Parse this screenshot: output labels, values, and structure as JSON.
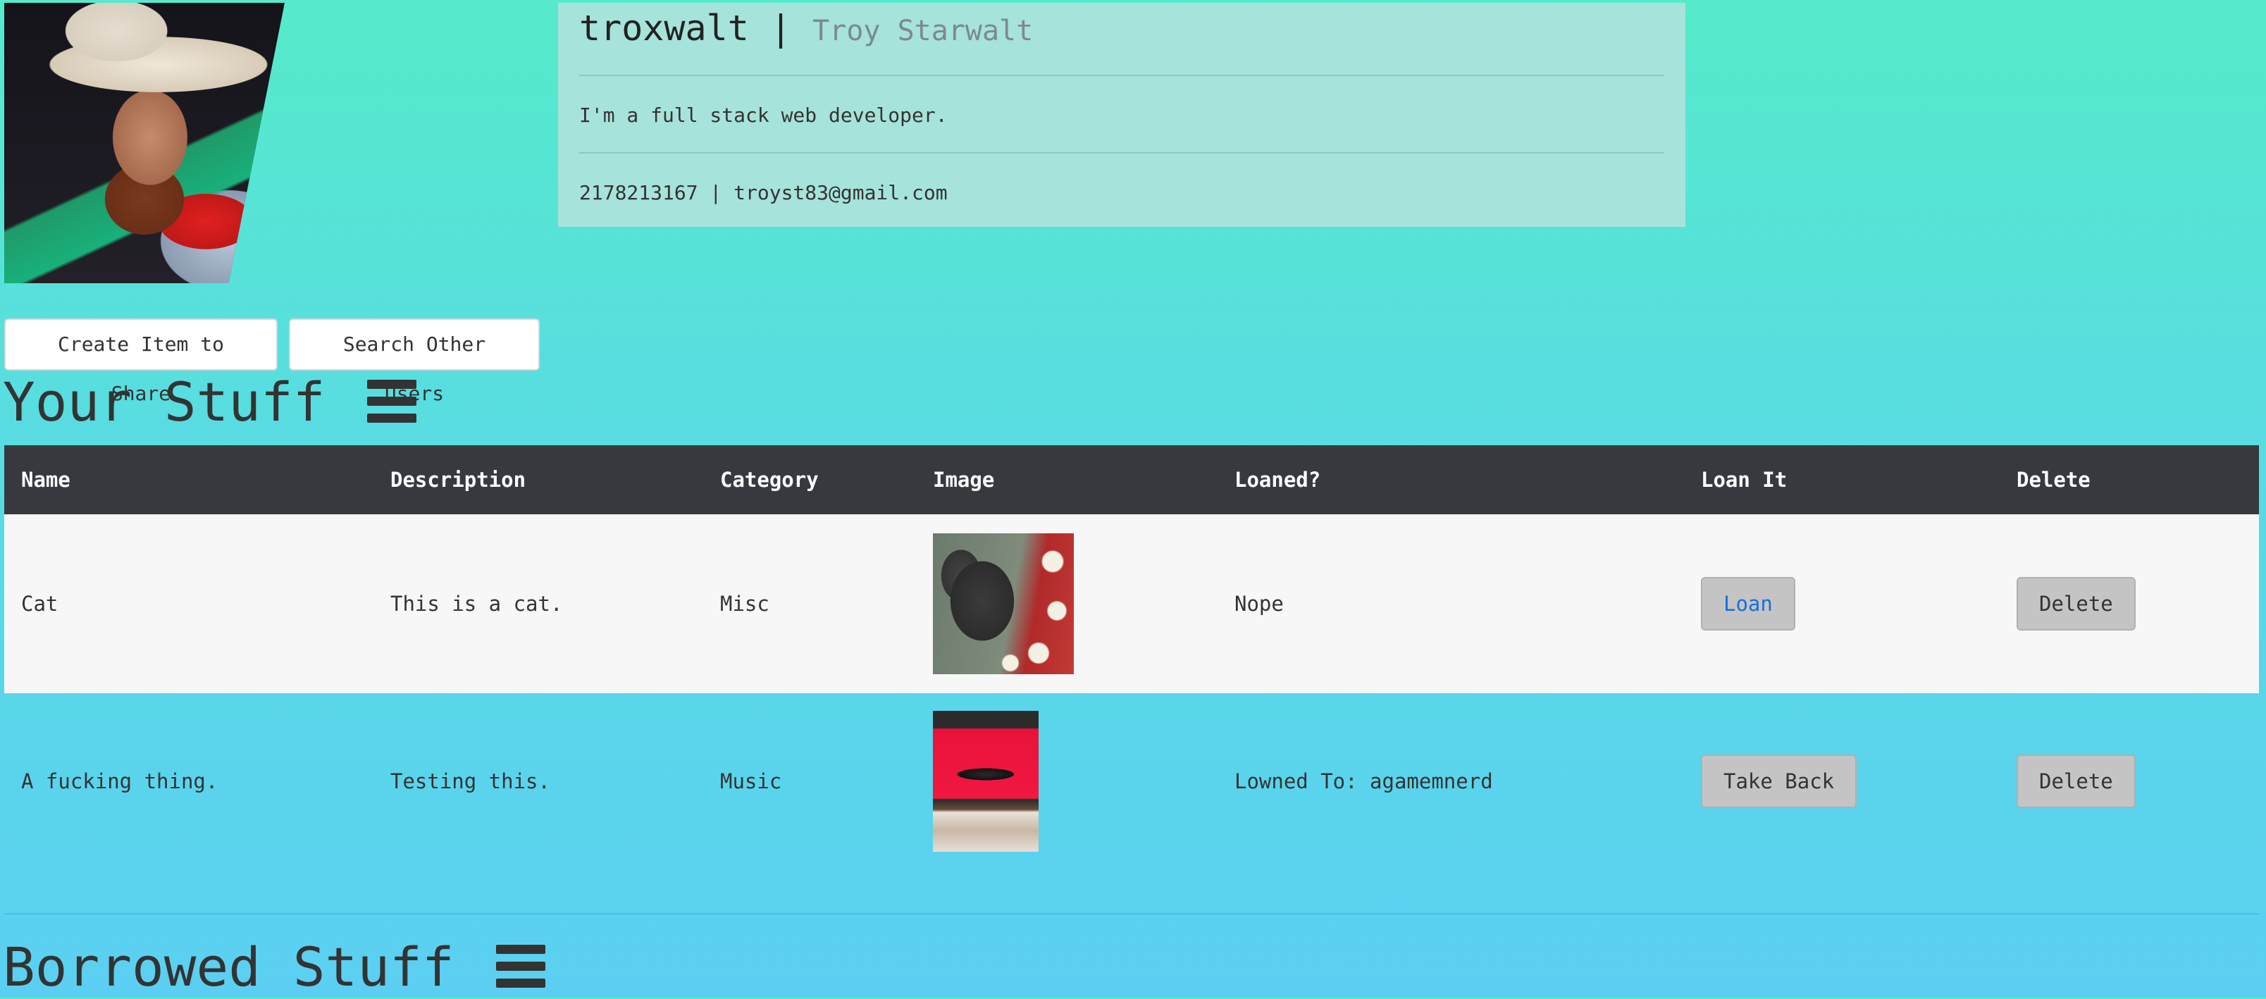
{
  "profile": {
    "username": "troxwalt",
    "separator": "|",
    "fullname": "Troy Starwalt",
    "bio": "I'm a full stack web developer.",
    "contact": "2178213167 | troyst83@gmail.com"
  },
  "actions": {
    "create_label": "Create Item to Share",
    "search_label": "Search Other Users"
  },
  "your_stuff": {
    "title": "Your Stuff",
    "columns": [
      "Name",
      "Description",
      "Category",
      "Image",
      "Loaned?",
      "Loan It",
      "Delete"
    ],
    "rows": [
      {
        "name": "Cat",
        "description": "This is a cat.",
        "category": "Misc",
        "image": "cat-photo",
        "loaned": "Nope",
        "loan_action": "Loan",
        "delete_action": "Delete"
      },
      {
        "name": "A fucking thing.",
        "description": "Testing this.",
        "category": "Music",
        "image": "red-case-photo",
        "loaned": "Lowned To: agamemnerd",
        "loan_action": "Take Back",
        "delete_action": "Delete"
      }
    ]
  },
  "borrowed_stuff": {
    "title": "Borrowed Stuff"
  },
  "colors": {
    "table_header_bg": "#363a3f",
    "profile_card_bg": "#a6e3da",
    "loan_link": "#1a6fd6"
  },
  "icons": {
    "section_menu": "hamburger-menu-icon"
  }
}
